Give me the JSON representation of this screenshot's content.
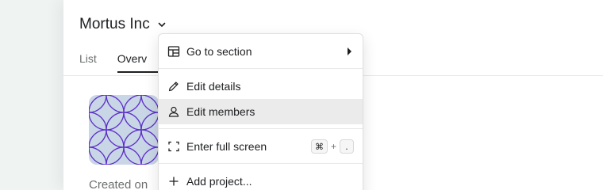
{
  "header": {
    "title": "Mortus Inc"
  },
  "tabs": [
    {
      "label": "List"
    },
    {
      "label": "Overv"
    }
  ],
  "overview": {
    "created_text": "Created on"
  },
  "menu": {
    "items": [
      {
        "label": "Go to section",
        "icon": "layout-icon",
        "has_submenu": true
      },
      {
        "label": "Edit details",
        "icon": "pencil-icon"
      },
      {
        "label": "Edit members",
        "icon": "person-icon",
        "highlighted": true
      },
      {
        "label": "Enter full screen",
        "icon": "fullscreen-icon",
        "shortcut": {
          "key1": "⌘",
          "joiner": "+",
          "key2": "."
        }
      },
      {
        "label": "Add project...",
        "icon": "plus-icon"
      }
    ]
  },
  "colors": {
    "active_tab_underline": "#1e1f21",
    "avatar_bg": "#c9d6e6",
    "avatar_pattern": "#5b2fc9",
    "hover_bg": "#ebebeb"
  }
}
